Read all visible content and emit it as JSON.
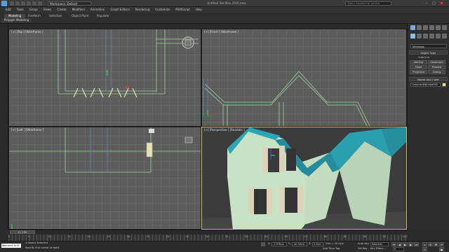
{
  "titlebar": {
    "workspace_label": "Workspace: Default",
    "window_title": "Untitled 3ds Max 2016.max",
    "search_placeholder": "Type a keyword or phrase"
  },
  "menu": [
    "Edit",
    "Tools",
    "Group",
    "Views",
    "Create",
    "Modifiers",
    "Animation",
    "Graph Editors",
    "Rendering",
    "Customize",
    "MAXScript",
    "Help"
  ],
  "ribbon": {
    "tabs": [
      "Modeling",
      "Freeform",
      "Selection",
      "Object Paint",
      "Populate"
    ],
    "active_tab": "Modeling",
    "sub_label": "Polygon Modeling"
  },
  "viewports": {
    "top": {
      "label": "[+] [Top ] [Wireframe ]"
    },
    "front": {
      "label": "[+] [Front ] [Wireframe ]"
    },
    "left": {
      "label": "[+] [Left ] [Wireframe ]"
    },
    "perspective": {
      "label": "[+] [Perspective ] [Realistic ]"
    }
  },
  "command_panel": {
    "dropdown_value": "Windows",
    "object_type_header": "Object Type",
    "autogrid_label": "AutoGrid",
    "buttons": [
      "Awning",
      "Casement",
      "Fixed",
      "Pivoted",
      "Projected",
      "Sliding"
    ],
    "name_color_header": "Name and Color",
    "name_value": "CasementWindow002"
  },
  "timeline": {
    "slider_label": "0 / 100",
    "ticks": [
      "0",
      "5",
      "10",
      "15",
      "20",
      "25",
      "30",
      "35",
      "40",
      "45",
      "50",
      "55",
      "60",
      "65",
      "70",
      "75",
      "80",
      "85",
      "90",
      "95",
      "100"
    ]
  },
  "status": {
    "welcome": "Welcome to M",
    "selected": "1 Object Selected",
    "prompt": "Specify first corner of bottl",
    "x_label": "X:",
    "x_value": "-1.378cm",
    "y_label": "Y:",
    "y_value": "-40.35cm",
    "z_label": "Z:",
    "z_value": "0.0cm",
    "grid": "Grid = 10.0cm",
    "add_time_tag": "Add Time Tag",
    "autokey": "Auto Key",
    "set_key": "Set Key",
    "key_filters": "Key Filters...",
    "selected_dropdown": "Selected",
    "frame": "0"
  }
}
